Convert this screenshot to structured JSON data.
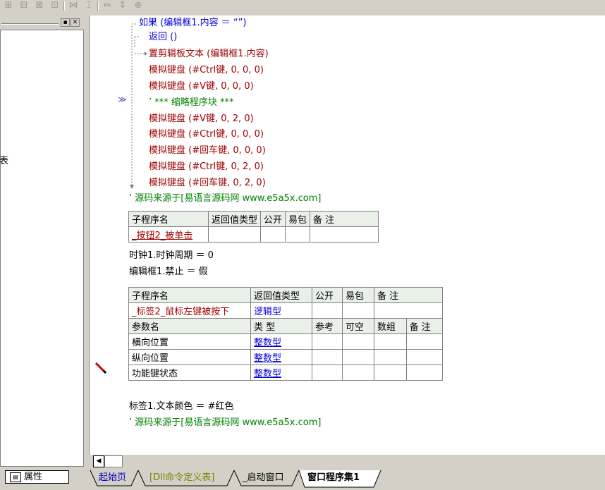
{
  "toolbar": {
    "icons": [
      "align-left-icon",
      "align-center-icon",
      "align-right-icon",
      "align-top-icon",
      "align-middle-icon",
      "align-bottom-icon",
      "same-width-icon",
      "same-height-icon",
      "same-size-icon"
    ]
  },
  "left_panel": {
    "partial_text": "表",
    "properties_tab": "属性"
  },
  "code_lines": [
    {
      "text": "如果 (编辑框1.内容 ＝ “”)",
      "color": "blue"
    },
    {
      "text": "返回 ()",
      "color": "blue"
    },
    {
      "text": "置剪辑板文本 (编辑框1.内容)",
      "color": "red"
    },
    {
      "text": "模拟键盘 (#Ctrl键, 0, 0, 0)",
      "color": "red"
    },
    {
      "text": "模拟键盘 (#V键, 0, 0, 0)",
      "color": "red"
    },
    {
      "text": "’ *** 缩略程序块 ***",
      "color": "green"
    },
    {
      "text": "模拟键盘 (#V键, 0, 2, 0)",
      "color": "red"
    },
    {
      "text": "模拟键盘 (#Ctrl键, 0, 0, 0)",
      "color": "red"
    },
    {
      "text": "模拟键盘 (#回车键, 0, 0, 0)",
      "color": "red"
    },
    {
      "text": "模拟键盘 (#Ctrl键, 0, 2, 0)",
      "color": "red"
    },
    {
      "text": "模拟键盘 (#回车键, 0, 2, 0)",
      "color": "red"
    }
  ],
  "comment1": "’ 源码来源于[易语言源码网 www.e5a5x.com]",
  "sub1": {
    "headers": [
      "子程序名",
      "返回值类型",
      "公开",
      "易包",
      "备 注"
    ],
    "row": [
      "_按钮2_被单击",
      "",
      "",
      "",
      ""
    ]
  },
  "stmt1": "时钟1.时钟周期 ＝ 0",
  "stmt2": "编辑框1.禁止 ＝ 假",
  "sub2": {
    "headers": [
      "子程序名",
      "返回值类型",
      "公开",
      "易包",
      "备 注"
    ],
    "row": [
      "_标签2_鼠标左键被按下",
      "逻辑型",
      "",
      "",
      ""
    ],
    "param_headers": [
      "参数名",
      "类 型",
      "参考",
      "可空",
      "数组",
      "备 注"
    ],
    "params": [
      [
        "横向位置",
        "整数型",
        "",
        "",
        "",
        ""
      ],
      [
        "纵向位置",
        "整数型",
        "",
        "",
        "",
        ""
      ],
      [
        "功能键状态",
        "整数型",
        "",
        "",
        "",
        ""
      ]
    ]
  },
  "stmt3": "标签1.文本颜色 ＝ #红色",
  "comment2": "’ 源码来源于[易语言源码网 www.e5a5x.com]",
  "tabs": [
    "起始页",
    "[Dll命令定义表]",
    "_启动窗口",
    "窗口程序集1"
  ],
  "colors": {
    "keyword": "#0000e0",
    "command": "#a00000",
    "comment": "#008000"
  }
}
